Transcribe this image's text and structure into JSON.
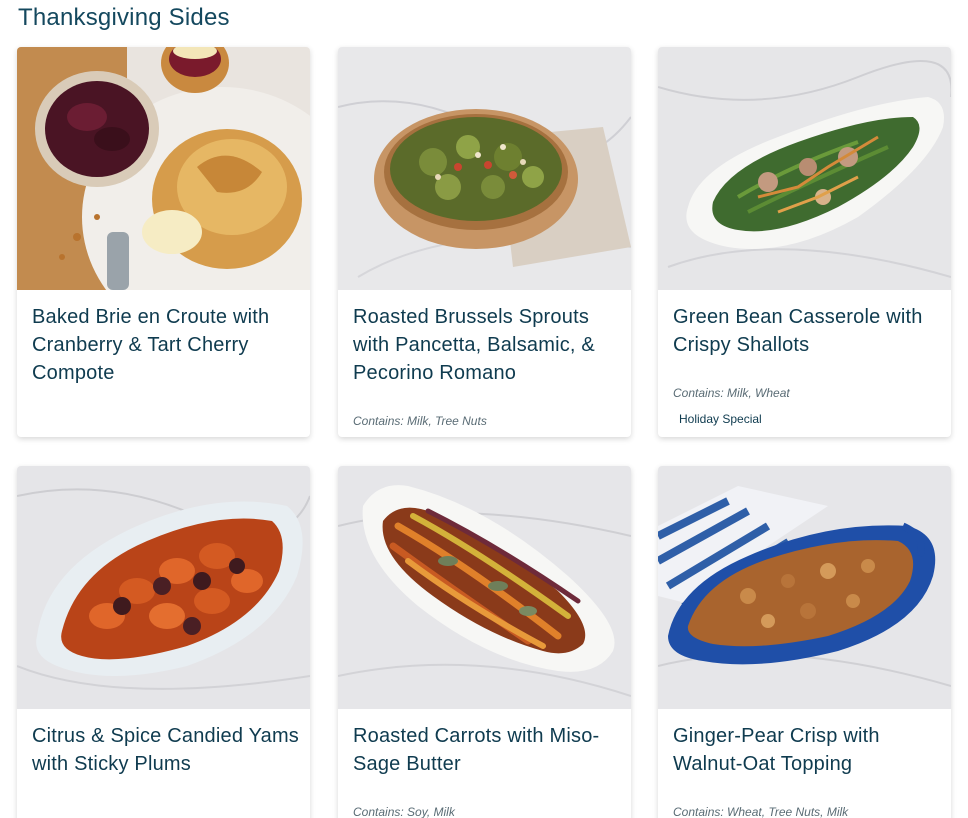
{
  "section": {
    "title": "Thanksgiving Sides"
  },
  "cards": [
    {
      "title": "Baked Brie en Croute with Cranberry & Tart Cherry Compote",
      "contains": "",
      "tag": "",
      "image": "brie-pastry-photo"
    },
    {
      "title": "Roasted Brussels Sprouts with Pancetta, Balsamic, & Pecorino Romano",
      "contains": "Contains: Milk, Tree Nuts",
      "tag": "",
      "image": "brussels-sprouts-photo"
    },
    {
      "title": "Green Bean Casserole with Crispy Shallots",
      "contains": "Contains: Milk, Wheat",
      "tag": "Holiday Special",
      "image": "green-bean-casserole-photo"
    },
    {
      "title": "Citrus & Spice Candied Yams with Sticky Plums",
      "contains": "",
      "tag": "",
      "image": "candied-yams-photo"
    },
    {
      "title": "Roasted Carrots with Miso-Sage Butter",
      "contains": "Contains: Soy, Milk",
      "tag": "",
      "image": "roasted-carrots-photo"
    },
    {
      "title": "Ginger-Pear Crisp with Walnut-Oat Topping",
      "contains": "Contains: Wheat, Tree Nuts, Milk",
      "tag": "",
      "image": "pear-crisp-photo"
    }
  ]
}
